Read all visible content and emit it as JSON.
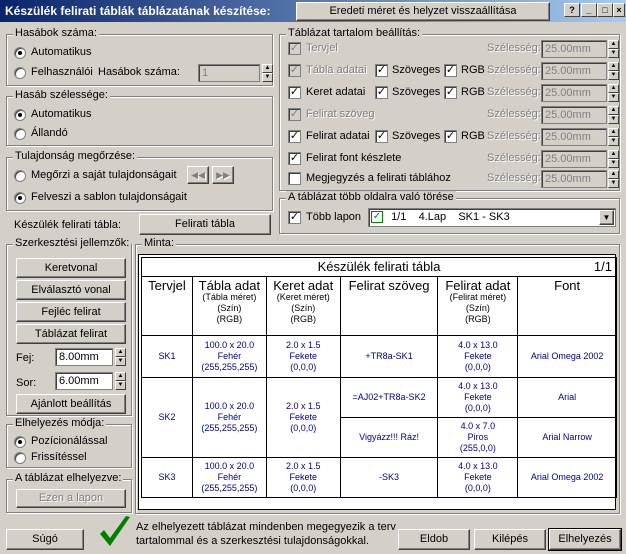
{
  "window": {
    "title": "Készülék felirati táblák táblázatának készítése:",
    "reset_button": "Eredeti méret és helyzet visszaállítása"
  },
  "columns_count": {
    "title": "Hasábok száma:",
    "auto": "Automatikus",
    "user": "Felhasználói",
    "count_label": "Hasábok száma:",
    "count_value": "1"
  },
  "column_width": {
    "title": "Hasáb szélessége:",
    "auto": "Automatikus",
    "fixed": "Állandó"
  },
  "property_keep": {
    "title": "Tulajdonság megőrzése:",
    "keep_own": "Megőrzi a saját tulajdonságait",
    "take_template": "Felveszi a sablon tulajdonságait"
  },
  "device_table": {
    "label": "Készülék felirati tábla:",
    "button": "Felirati tábla"
  },
  "edit_features": {
    "title": "Szerkesztési jellemzők:",
    "frame_line": "Keretvonal",
    "separator_line": "Elválasztó vonal",
    "header_label": "Fejléc felirat",
    "table_label": "Táblázat felirat",
    "head_label": "Fej:",
    "head_value": "8.00mm",
    "row_label": "Sor:",
    "row_value": "6.00mm",
    "recommended": "Ajánlott beállítás"
  },
  "placement_mode": {
    "title": "Elhelyezés módja:",
    "positional": "Pozícionálással",
    "refresh": "Frissítéssel"
  },
  "placed": {
    "title": "A táblázat elhelyezve:",
    "button": "Ezen a lapon"
  },
  "content_settings": {
    "title": "Táblázat tartalom beállítás:",
    "width_label": "Szélesség:",
    "textual": "Szöveges",
    "rgb": "RGB",
    "rows": [
      {
        "label": "Tervjel",
        "checked": true,
        "disabled": true,
        "width": "25.00mm"
      },
      {
        "label": "Tábla adatai",
        "checked": true,
        "disabled": true,
        "width": "25.00mm"
      },
      {
        "label": "Keret adatai",
        "checked": true,
        "disabled": false,
        "width": "25.00mm"
      },
      {
        "label": "Felirat szöveg",
        "checked": true,
        "disabled": true,
        "width": "25.00mm"
      },
      {
        "label": "Felirat adatai",
        "checked": true,
        "disabled": false,
        "width": "25.00mm"
      },
      {
        "label": "Felirat font készlete",
        "checked": true,
        "disabled": false,
        "width": "25.00mm"
      },
      {
        "label": "Megjegyzés a felirati táblához",
        "checked": false,
        "disabled": false,
        "width": "25.00mm"
      }
    ]
  },
  "page_break": {
    "title": "A táblázat több oldalra való törése",
    "multi_page": "Több lapon",
    "select_value": "1/1    4.Lap    SK1 - SK3"
  },
  "sample": {
    "title": "Minta:",
    "table_title": "Készülék felirati tábla",
    "page": "1/1",
    "headers": [
      "Tervjel",
      "Tábla adat",
      "Keret adat",
      "Felirat szöveg",
      "Felirat adat",
      "Font"
    ],
    "header_subs": [
      [
        "",
        ""
      ],
      [
        "(Tábla méret)",
        "(Szín)",
        "(RGB)"
      ],
      [
        "(Keret méret)",
        "(Szín)",
        "(RGB)"
      ],
      [],
      [
        "(Felirat méret)",
        "(Szín)",
        "(RGB)"
      ],
      []
    ],
    "rows": [
      {
        "id": "SK1",
        "table": [
          "100.0 x 20.0",
          "Fehér",
          "(255,255,255)"
        ],
        "frame": [
          "2.0 x 1.5",
          "Fekete",
          "(0,0,0)"
        ],
        "labels": [
          {
            "text": "+TR8a-SK1",
            "data": [
              "4.0 x 13.0",
              "Fekete",
              "(0,0,0)"
            ],
            "font": "Arial Omega 2002"
          }
        ]
      },
      {
        "id": "SK2",
        "table": [
          "100.0 x 20.0",
          "Fehér",
          "(255,255,255)"
        ],
        "frame": [
          "2.0 x 1.5",
          "Fekete",
          "(0,0,0)"
        ],
        "labels": [
          {
            "text": "=AJ02+TR8a-SK2",
            "data": [
              "4.0 x 13.0",
              "Fekete",
              "(0,0,0)"
            ],
            "font": "Arial"
          },
          {
            "text": "Vigyázz!!! Ráz!",
            "data": [
              "4.0 x 7.0",
              "Piros",
              "(255,0,0)"
            ],
            "font": "Arial Narrow"
          }
        ]
      },
      {
        "id": "SK3",
        "table": [
          "100.0 x 20.0",
          "Fehér",
          "(255,255,255)"
        ],
        "frame": [
          "2.0 x 1.5",
          "Fekete",
          "(0,0,0)"
        ],
        "labels": [
          {
            "text": "-SK3",
            "data": [
              "4.0 x 13.0",
              "Fekete",
              "(0,0,0)"
            ],
            "font": "Arial Omega 2002"
          }
        ]
      }
    ]
  },
  "footer": {
    "help": "Súgó",
    "message": "Az elhelyezett táblázat mindenben megegyezik a terv tartalommal és a szerkesztési tulajdonságokkal.",
    "discard": "Eldob",
    "exit": "Kilépés",
    "place": "Elhelyezés"
  },
  "icons": {
    "ok": "check-icon",
    "prev": "rewind-icon",
    "next": "fast-forward-icon"
  },
  "colors": {
    "accent": "#0a246a",
    "check": "#008000"
  }
}
